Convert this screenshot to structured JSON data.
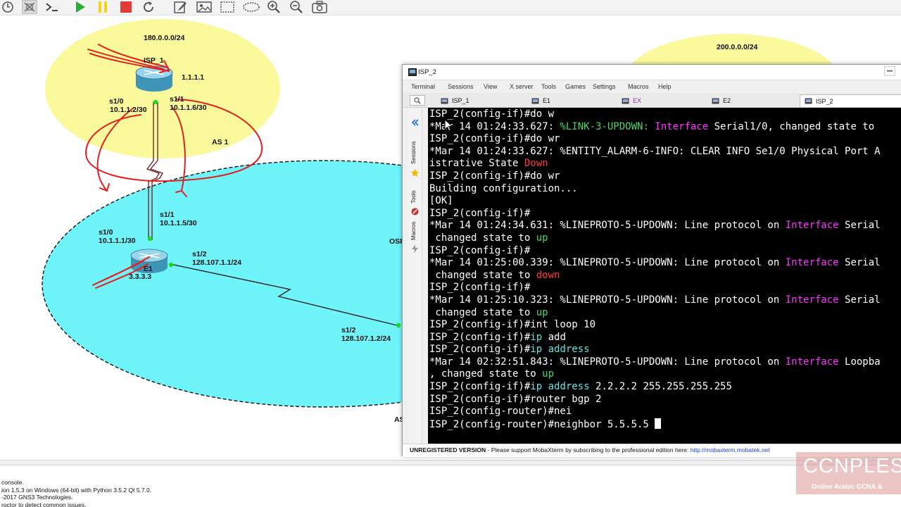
{
  "colors": {
    "cloud_yellow": "#fafa9c",
    "as_cyan": "#6ff4fa",
    "annotation_red": "#e32020",
    "terminal_bg": "#000000",
    "link_blue": "#1a3fd6"
  },
  "toolbar": {
    "icons": [
      "clock-icon",
      "snapshot-icon",
      "console-icon",
      "start-icon",
      "pause-icon",
      "stop-icon",
      "reload-icon",
      "edit-icon",
      "image-icon",
      "rectangle-icon",
      "ellipse-icon",
      "zoom-in-icon",
      "zoom-out-icon",
      "screenshot-icon"
    ]
  },
  "topology": {
    "isp1_cloud_label": "180.0.0.0/24",
    "isp2_cloud_label": "200.0.0.0/24",
    "isp1_router_name": "ISP_1",
    "isp1_loopback": "1.1.1.1",
    "isp1_s10": "s1/0",
    "isp1_s10_ip": "10.1.1.2/30",
    "isp1_s11": "s1/1",
    "isp1_s11_ip": "10.1.1.6/30",
    "as1_label": "AS 1",
    "r1_s11": "s1/1",
    "r1_s11_ip": "10.1.1.5/30",
    "r1_s10": "s1/0",
    "r1_s10_ip": "10.1.1.1/30",
    "r1_s12": "s1/2",
    "r1_s12_ip": "128.107.1.1/24",
    "r1_name": "E1",
    "r1_loopback": "3.3.3.3",
    "remote_s12": "s1/2",
    "remote_s12_ip": "128.107.1.2/24",
    "ospf_clip": "OSP",
    "as_clip": "AS"
  },
  "moba": {
    "window_title": "ISP_2",
    "menu": [
      "Terminal",
      "Sessions",
      "View",
      "X server",
      "Tools",
      "Games",
      "Settings",
      "Macros",
      "Help"
    ],
    "tabs": [
      {
        "label": "ISP_1",
        "active": false
      },
      {
        "label": "E1",
        "active": false
      },
      {
        "label": "EX",
        "active": false
      },
      {
        "label": "E2",
        "active": false
      },
      {
        "label": "ISP_2",
        "active": true
      }
    ],
    "sidebar": [
      "Sessions",
      "Tools",
      "Macros"
    ],
    "status_unregistered": "UNREGISTERED VERSION",
    "status_text": " -  Please support MobaXterm by subscribing to the professional edition here: ",
    "status_link": "http://mobaxterm.mobatek.net"
  },
  "terminal": {
    "lines": [
      [
        {
          "t": "ISP_2(config-if)#do w"
        }
      ],
      [
        {
          "t": "*Mar 14 01:24:33.627: "
        },
        {
          "t": "%LINK-3-UPDOWN: ",
          "c": "grn"
        },
        {
          "t": "Interface",
          "c": "mag"
        },
        {
          "t": " Serial1/0, changed state to "
        }
      ],
      [
        {
          "t": "ISP_2(config-if)#do wr"
        }
      ],
      [
        {
          "t": "*Mar 14 01:24:33.627: %ENTITY_ALARM-6-INFO: CLEAR INFO Se1/0 Physical Port A"
        }
      ],
      [
        {
          "t": "istrative State "
        },
        {
          "t": "Down",
          "c": "red"
        }
      ],
      [
        {
          "t": "ISP_2(config-if)#do wr"
        }
      ],
      [
        {
          "t": "Building configuration..."
        }
      ],
      [
        {
          "t": "[OK]"
        }
      ],
      [
        {
          "t": "ISP_2(config-if)#"
        }
      ],
      [
        {
          "t": "*Mar 14 01:24:34.631: %LINEPROTO-5-UPDOWN: Line protocol on "
        },
        {
          "t": "Interface",
          "c": "mag"
        },
        {
          "t": " Serial"
        }
      ],
      [
        {
          "t": " changed state to "
        },
        {
          "t": "up",
          "c": "grn"
        }
      ],
      [
        {
          "t": "ISP_2(config-if)#"
        }
      ],
      [
        {
          "t": "*Mar 14 01:25:00.339: %LINEPROTO-5-UPDOWN: Line protocol on "
        },
        {
          "t": "Interface",
          "c": "mag"
        },
        {
          "t": " Serial"
        }
      ],
      [
        {
          "t": " changed state to "
        },
        {
          "t": "down",
          "c": "red"
        }
      ],
      [
        {
          "t": "ISP_2(config-if)#"
        }
      ],
      [
        {
          "t": "*Mar 14 01:25:10.323: %LINEPROTO-5-UPDOWN: Line protocol on "
        },
        {
          "t": "Interface",
          "c": "mag"
        },
        {
          "t": " Serial"
        }
      ],
      [
        {
          "t": " changed state to "
        },
        {
          "t": "up",
          "c": "grn"
        }
      ],
      [
        {
          "t": "ISP_2(config-if)#int loop 10"
        }
      ],
      [
        {
          "t": "ISP_2(config-if)#"
        },
        {
          "t": "ip",
          "c": "cyan"
        },
        {
          "t": " add"
        }
      ],
      [
        {
          "t": "ISP_2(config-if)#"
        },
        {
          "t": "ip address",
          "c": "cyan"
        }
      ],
      [
        {
          "t": "*Mar 14 02:32:51.843: %LINEPROTO-5-UPDOWN: Line protocol on "
        },
        {
          "t": "Interface",
          "c": "mag"
        },
        {
          "t": " Loopba"
        }
      ],
      [
        {
          "t": ", changed state to "
        },
        {
          "t": "up",
          "c": "grn"
        }
      ],
      [
        {
          "t": "ISP_2(config-if)#"
        },
        {
          "t": "ip address",
          "c": "cyan"
        },
        {
          "t": " 2.2.2.2 255.255.255.255"
        }
      ],
      [
        {
          "t": "ISP_2(config-if)#router bgp 2"
        }
      ],
      [
        {
          "t": "ISP_2(config-router)#nei"
        }
      ],
      [
        {
          "t": "ISP_2(config-router)#neighbor 5.5.5.5 "
        }
      ]
    ]
  },
  "console": {
    "lines": [
      "console.",
      "ion 1.5.3 on Windows (64-bit) with Python 3.5.2 Qt 5.7.0.",
      "-2017 GNS3 Technologies.",
      "roctor to detect common issues."
    ]
  },
  "watermark": {
    "big": "CCNPLES",
    "small": "Online Arabic CCNA &"
  }
}
